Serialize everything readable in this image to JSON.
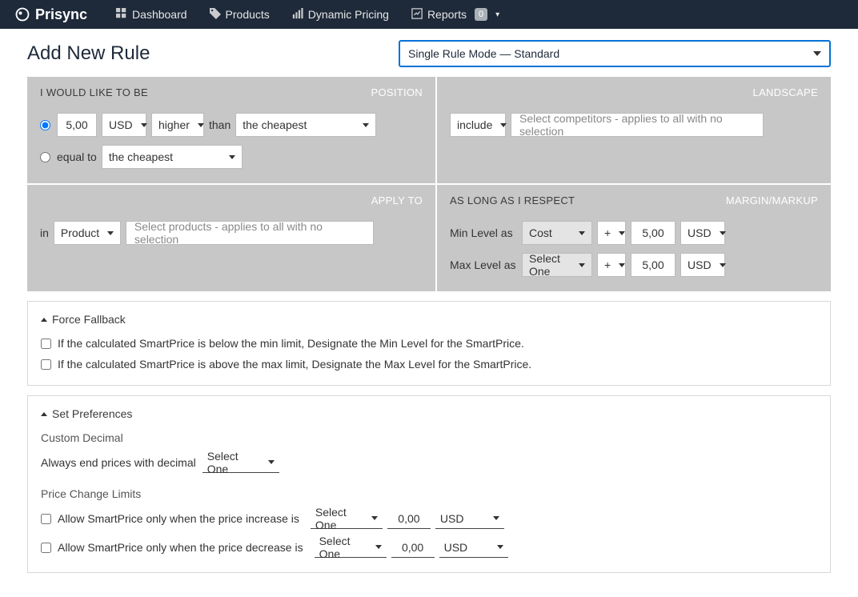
{
  "nav": {
    "brand": "Prisync",
    "items": [
      {
        "label": "Dashboard"
      },
      {
        "label": "Products"
      },
      {
        "label": "Dynamic Pricing"
      },
      {
        "label": "Reports",
        "badge": "0"
      }
    ]
  },
  "page": {
    "title": "Add New Rule",
    "mode_select": "Single Rule Mode — Standard"
  },
  "position": {
    "header_left": "I WOULD LIKE TO BE",
    "header_right": "POSITION",
    "amount": "5,00",
    "currency": "USD",
    "direction": "higher",
    "than": "than",
    "target": "the cheapest",
    "equal_label": "equal to",
    "equal_target": "the cheapest"
  },
  "landscape": {
    "header_right": "LANDSCAPE",
    "mode": "include",
    "placeholder": "Select competitors - applies to all with no selection"
  },
  "apply": {
    "header_right": "APPLY TO",
    "in": "in",
    "scope": "Product",
    "placeholder": "Select products - applies to all with no selection"
  },
  "margin": {
    "header_left": "AS LONG AS I RESPECT",
    "header_right": "MARGIN/MARKUP",
    "min_label": "Min Level as",
    "min_basis": "Cost",
    "min_op": "+",
    "min_amount": "5,00",
    "min_unit": "USD",
    "max_label": "Max Level as",
    "max_basis": "Select One",
    "max_op": "+",
    "max_amount": "5,00",
    "max_unit": "USD"
  },
  "fallback": {
    "title": "Force Fallback",
    "opt1": "If the calculated SmartPrice is below the min limit, Designate the Min Level for the SmartPrice.",
    "opt2": "If the calculated SmartPrice is above the max limit, Designate the Max Level for the SmartPrice."
  },
  "prefs": {
    "title": "Set Preferences",
    "custom_decimal": "Custom Decimal",
    "always_end": "Always end prices with decimal",
    "decimal_select": "Select One",
    "limits_title": "Price Change Limits",
    "allow_increase": "Allow SmartPrice only when the price increase is",
    "allow_decrease": "Allow SmartPrice only when the price decrease is",
    "sel": "Select One",
    "val": "0,00",
    "unit": "USD"
  }
}
